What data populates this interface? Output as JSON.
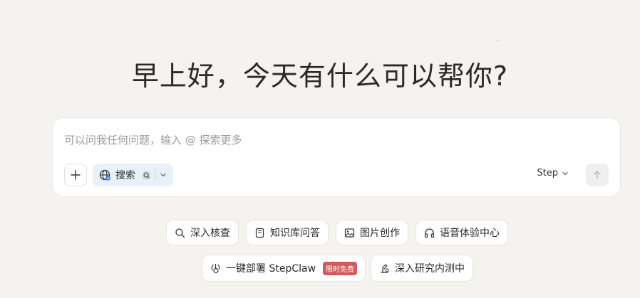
{
  "greeting": "早上好，今天有什么可以帮你?",
  "composer": {
    "placeholder": "可以问我任何问题，输入 @ 探索更多",
    "search_label": "搜索",
    "model": "Step"
  },
  "quick_actions": {
    "row1": [
      {
        "label": "深入核查",
        "icon": "search-check-icon"
      },
      {
        "label": "知识库问答",
        "icon": "book-icon"
      },
      {
        "label": "图片创作",
        "icon": "image-icon"
      },
      {
        "label": "语音体验中心",
        "icon": "headphones-icon"
      }
    ],
    "row2": [
      {
        "label": "一键部署 StepClaw",
        "icon": "claw-icon",
        "badge": "限时免费"
      },
      {
        "label": "深入研究内测中",
        "icon": "research-icon"
      }
    ]
  },
  "colors": {
    "background": "#f4f3f0",
    "search_chip": "#e8f0f9",
    "badge": "#d25a5a"
  }
}
